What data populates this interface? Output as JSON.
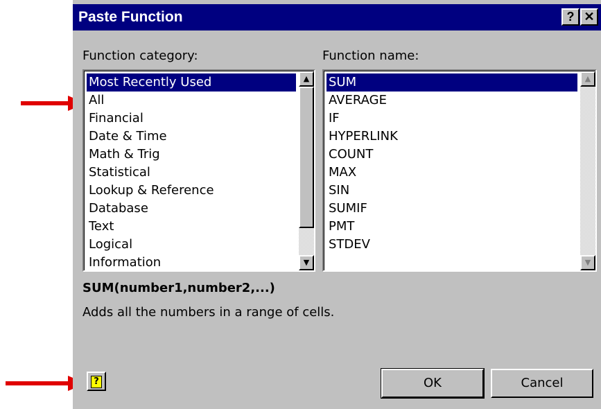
{
  "dialog": {
    "title": "Paste Function",
    "help_glyph": "?",
    "close_glyph": "✕"
  },
  "category": {
    "label": "Function category:",
    "items": [
      "Most Recently Used",
      "All",
      "Financial",
      "Date & Time",
      "Math & Trig",
      "Statistical",
      "Lookup & Reference",
      "Database",
      "Text",
      "Logical",
      "Information"
    ],
    "selected_index": 0
  },
  "functions": {
    "label": "Function name:",
    "items": [
      "SUM",
      "AVERAGE",
      "IF",
      "HYPERLINK",
      "COUNT",
      "MAX",
      "SIN",
      "SUMIF",
      "PMT",
      "STDEV"
    ],
    "selected_index": 0
  },
  "description": {
    "signature": "SUM(number1,number2,...)",
    "text": "Adds all the numbers in a range of cells."
  },
  "buttons": {
    "help_icon_glyph": "?",
    "ok": "OK",
    "cancel": "Cancel"
  },
  "colors": {
    "title_bar": "#000080",
    "selection": "#000080",
    "face": "#c0c0c0",
    "annotation_arrow": "#e00000"
  }
}
